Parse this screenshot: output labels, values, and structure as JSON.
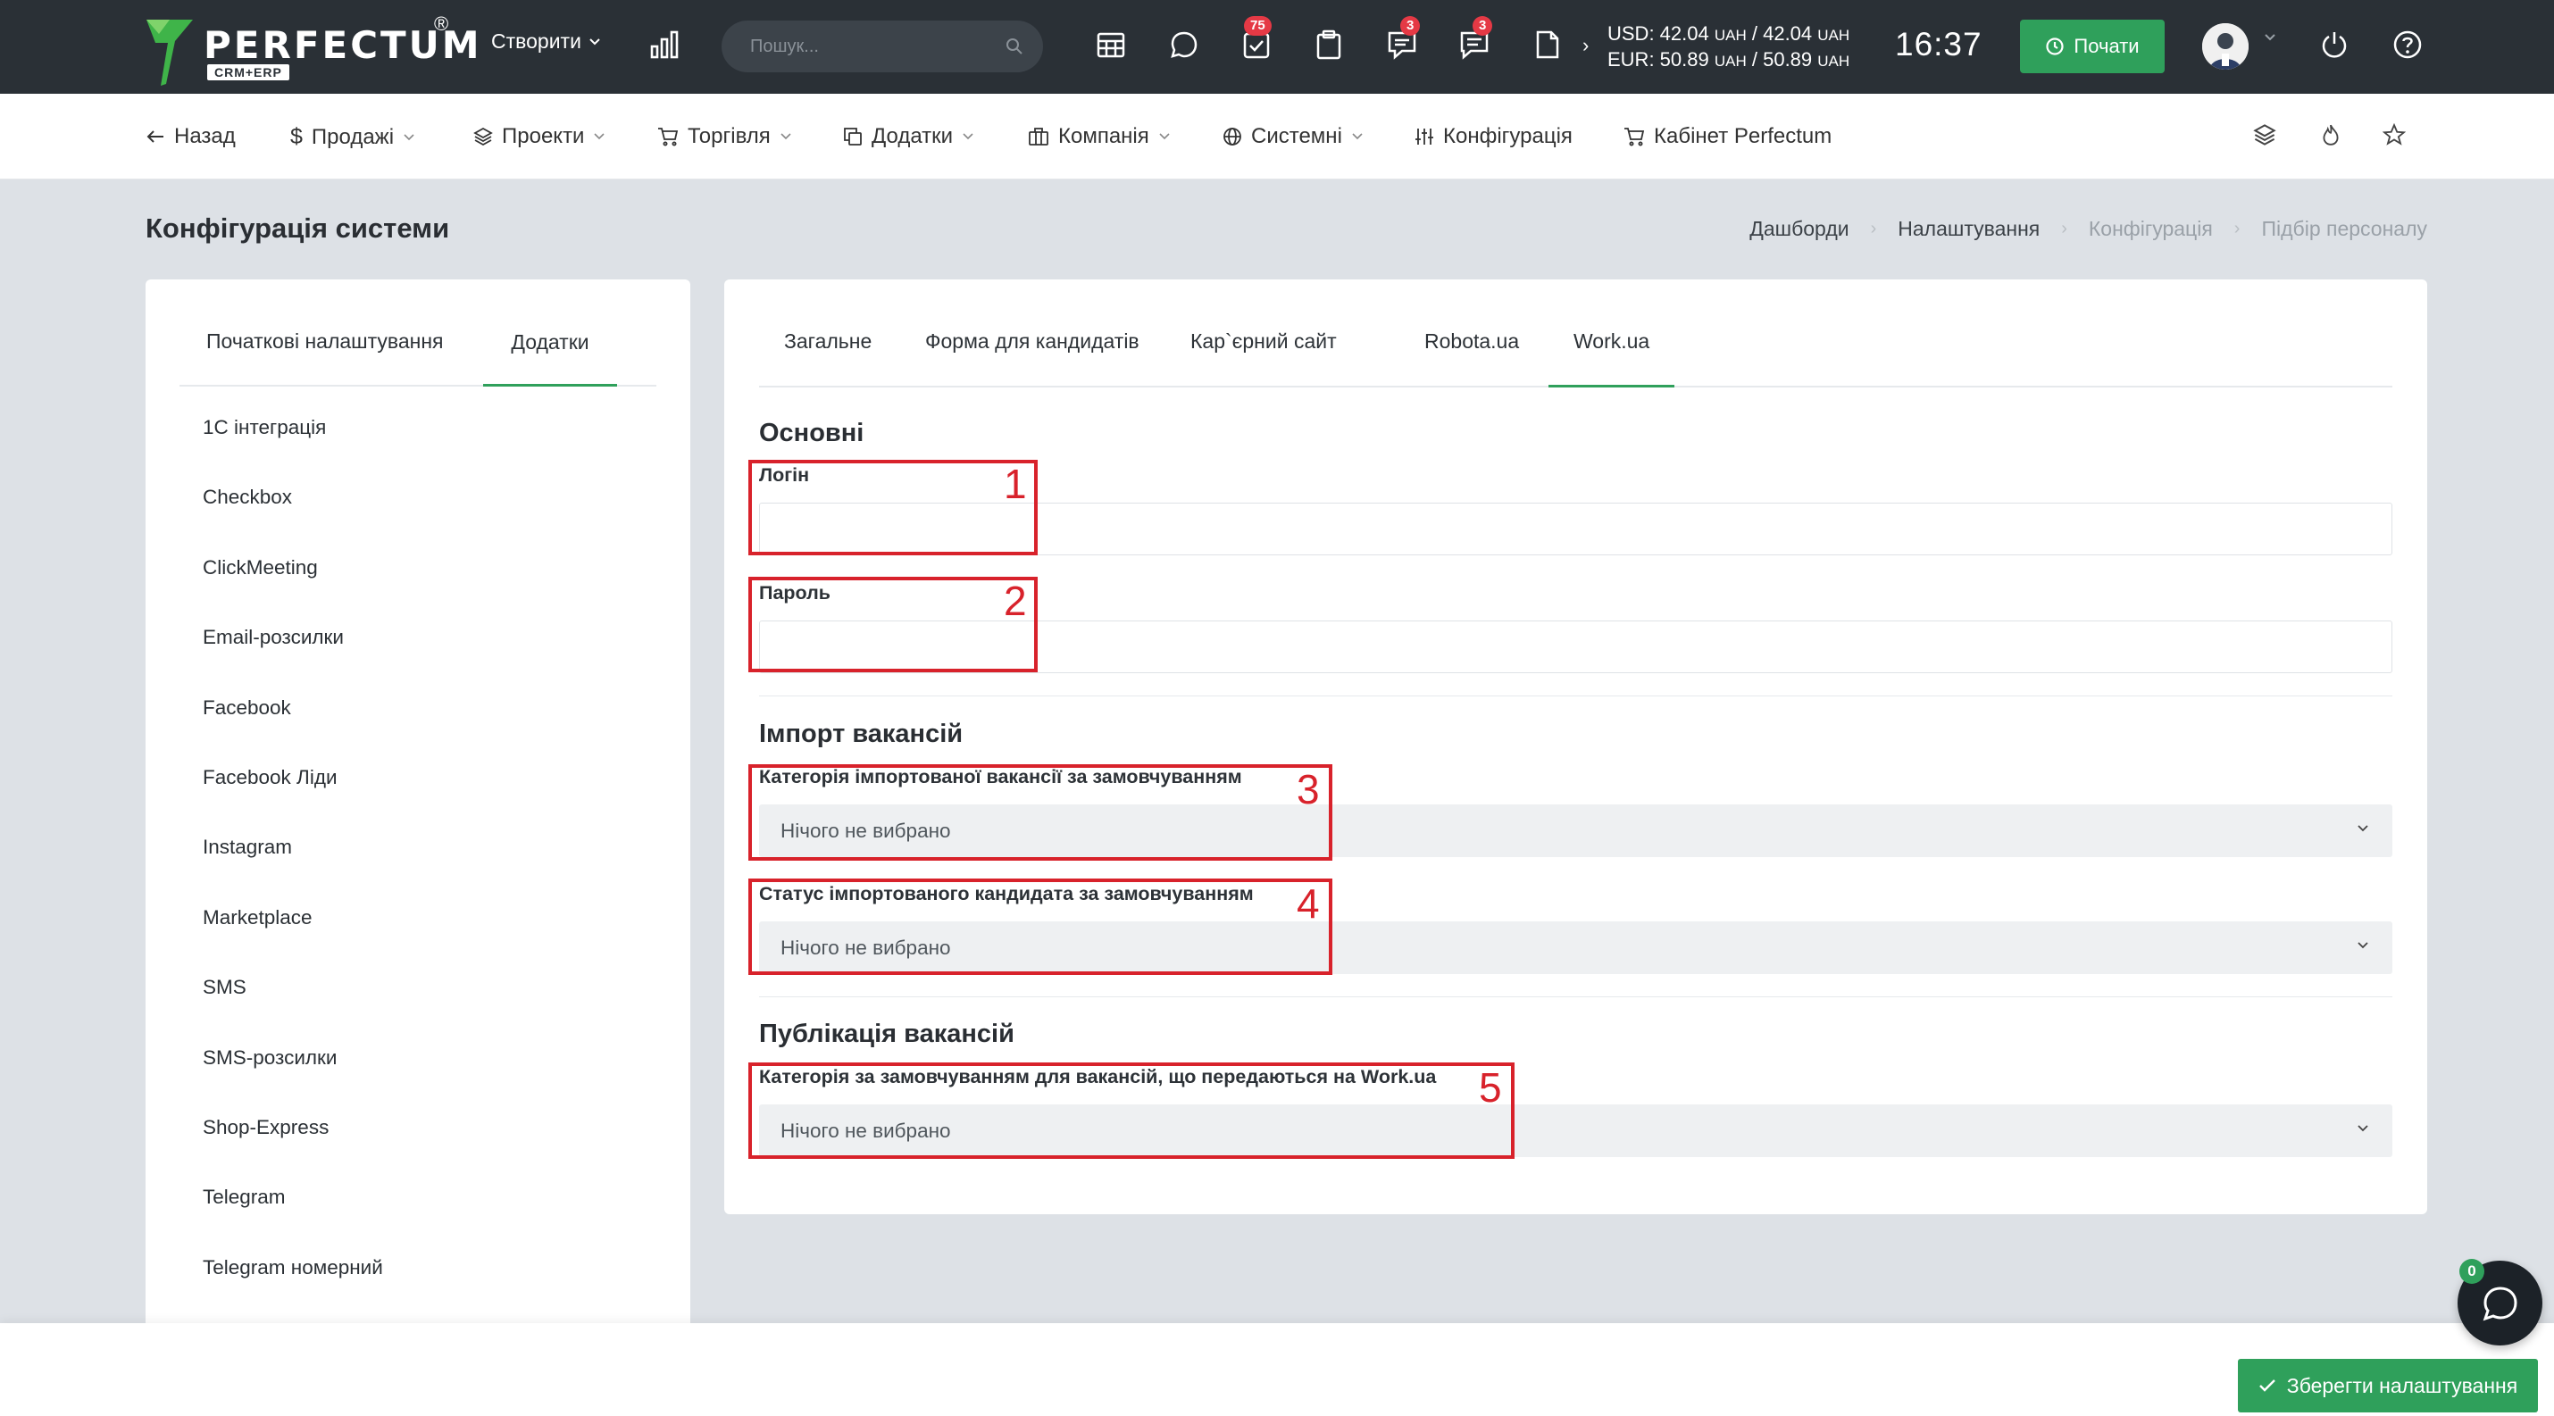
{
  "app": {
    "brand": "PERFECTUM",
    "brand_reg": "®",
    "brand_sub": "CRM+ERP"
  },
  "topbar": {
    "create_label": "Створити",
    "search_placeholder": "Пошук...",
    "badges": {
      "tasks": "75",
      "messages": "3",
      "comments": "3"
    },
    "rates": {
      "usd": "USD: 42.04",
      "usd_unit1": "UAH",
      "usd_sep": " / 42.04",
      "usd_unit2": "UAH",
      "eur": "EUR: 50.89",
      "eur_unit1": "UAH",
      "eur_sep": " / 50.89",
      "eur_unit2": "UAH"
    },
    "clock": "16:37",
    "start_label": "Почати"
  },
  "nav": {
    "back": "Назад",
    "sales": "Продажі",
    "projects": "Проекти",
    "trade": "Торгівля",
    "addons": "Додатки",
    "company": "Компанія",
    "system": "Системні",
    "config": "Конфігурація",
    "cabinet": "Кабінет Perfectum"
  },
  "page": {
    "title": "Конфігурація системи",
    "breadcrumb": [
      "Дашборди",
      "Налаштування",
      "Конфігурація",
      "Підбір персоналу"
    ]
  },
  "left_panel": {
    "tabs": [
      "Початкові налаштування",
      "Додатки"
    ],
    "items": [
      "1C інтеграція",
      "Checkbox",
      "ClickMeeting",
      "Email-розсилки",
      "Facebook",
      "Facebook Ліди",
      "Instagram",
      "Marketplace",
      "SMS",
      "SMS-розсилки",
      "Shop-Express",
      "Telegram",
      "Telegram номерний"
    ]
  },
  "main_panel": {
    "tabs": [
      "Загальне",
      "Форма для кандидатів",
      "Кар`єрний сайт",
      "Robota.ua",
      "Work.ua"
    ],
    "section_basic": "Основні",
    "login_label": "Логін",
    "login_value": "",
    "password_label": "Пароль",
    "password_value": "",
    "section_import": "Імпорт вакансій",
    "import_category_label": "Категорія імпортованої вакансії за замовчуванням",
    "import_category_value": "Нічого не вибрано",
    "import_status_label": "Статус імпортованого кандидата за замовчуванням",
    "import_status_value": "Нічого не вибрано",
    "section_publish": "Публікація вакансій",
    "publish_category_label": "Категорія за замовчуванням для вакансій, що передаються на Work.ua",
    "publish_category_value": "Нічого не вибрано"
  },
  "annotations": [
    "1",
    "2",
    "3",
    "4",
    "5"
  ],
  "footer": {
    "save_label": "Зберегти налаштування"
  },
  "chat": {
    "count": "0"
  },
  "colors": {
    "accent": "#2fa05b",
    "topbar": "#2a3036",
    "badge": "#e53945",
    "annotation": "#d8222b"
  }
}
